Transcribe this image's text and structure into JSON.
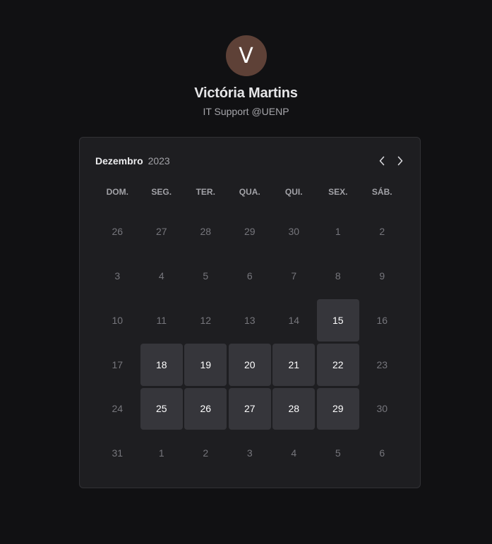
{
  "profile": {
    "avatar_initial": "V",
    "avatar_color": "#5e4137",
    "name": "Victória Martins",
    "role": "IT Support @UENP"
  },
  "calendar": {
    "month": "Dezembro",
    "year": "2023",
    "prev_icon": "chevron-left-icon",
    "next_icon": "chevron-right-icon",
    "weekdays": [
      "DOM.",
      "SEG.",
      "TER.",
      "QUA.",
      "QUI.",
      "SEX.",
      "SÁB."
    ],
    "weeks": [
      [
        {
          "d": "26",
          "active": false
        },
        {
          "d": "27",
          "active": false
        },
        {
          "d": "28",
          "active": false
        },
        {
          "d": "29",
          "active": false
        },
        {
          "d": "30",
          "active": false
        },
        {
          "d": "1",
          "active": false
        },
        {
          "d": "2",
          "active": false
        }
      ],
      [
        {
          "d": "3",
          "active": false
        },
        {
          "d": "4",
          "active": false
        },
        {
          "d": "5",
          "active": false
        },
        {
          "d": "6",
          "active": false
        },
        {
          "d": "7",
          "active": false
        },
        {
          "d": "8",
          "active": false
        },
        {
          "d": "9",
          "active": false
        }
      ],
      [
        {
          "d": "10",
          "active": false
        },
        {
          "d": "11",
          "active": false
        },
        {
          "d": "12",
          "active": false
        },
        {
          "d": "13",
          "active": false
        },
        {
          "d": "14",
          "active": false
        },
        {
          "d": "15",
          "active": true
        },
        {
          "d": "16",
          "active": false
        }
      ],
      [
        {
          "d": "17",
          "active": false
        },
        {
          "d": "18",
          "active": true
        },
        {
          "d": "19",
          "active": true
        },
        {
          "d": "20",
          "active": true
        },
        {
          "d": "21",
          "active": true
        },
        {
          "d": "22",
          "active": true
        },
        {
          "d": "23",
          "active": false
        }
      ],
      [
        {
          "d": "24",
          "active": false
        },
        {
          "d": "25",
          "active": true
        },
        {
          "d": "26",
          "active": true
        },
        {
          "d": "27",
          "active": true
        },
        {
          "d": "28",
          "active": true
        },
        {
          "d": "29",
          "active": true
        },
        {
          "d": "30",
          "active": false
        }
      ],
      [
        {
          "d": "31",
          "active": false
        },
        {
          "d": "1",
          "active": false
        },
        {
          "d": "2",
          "active": false
        },
        {
          "d": "3",
          "active": false
        },
        {
          "d": "4",
          "active": false
        },
        {
          "d": "5",
          "active": false
        },
        {
          "d": "6",
          "active": false
        }
      ]
    ]
  }
}
